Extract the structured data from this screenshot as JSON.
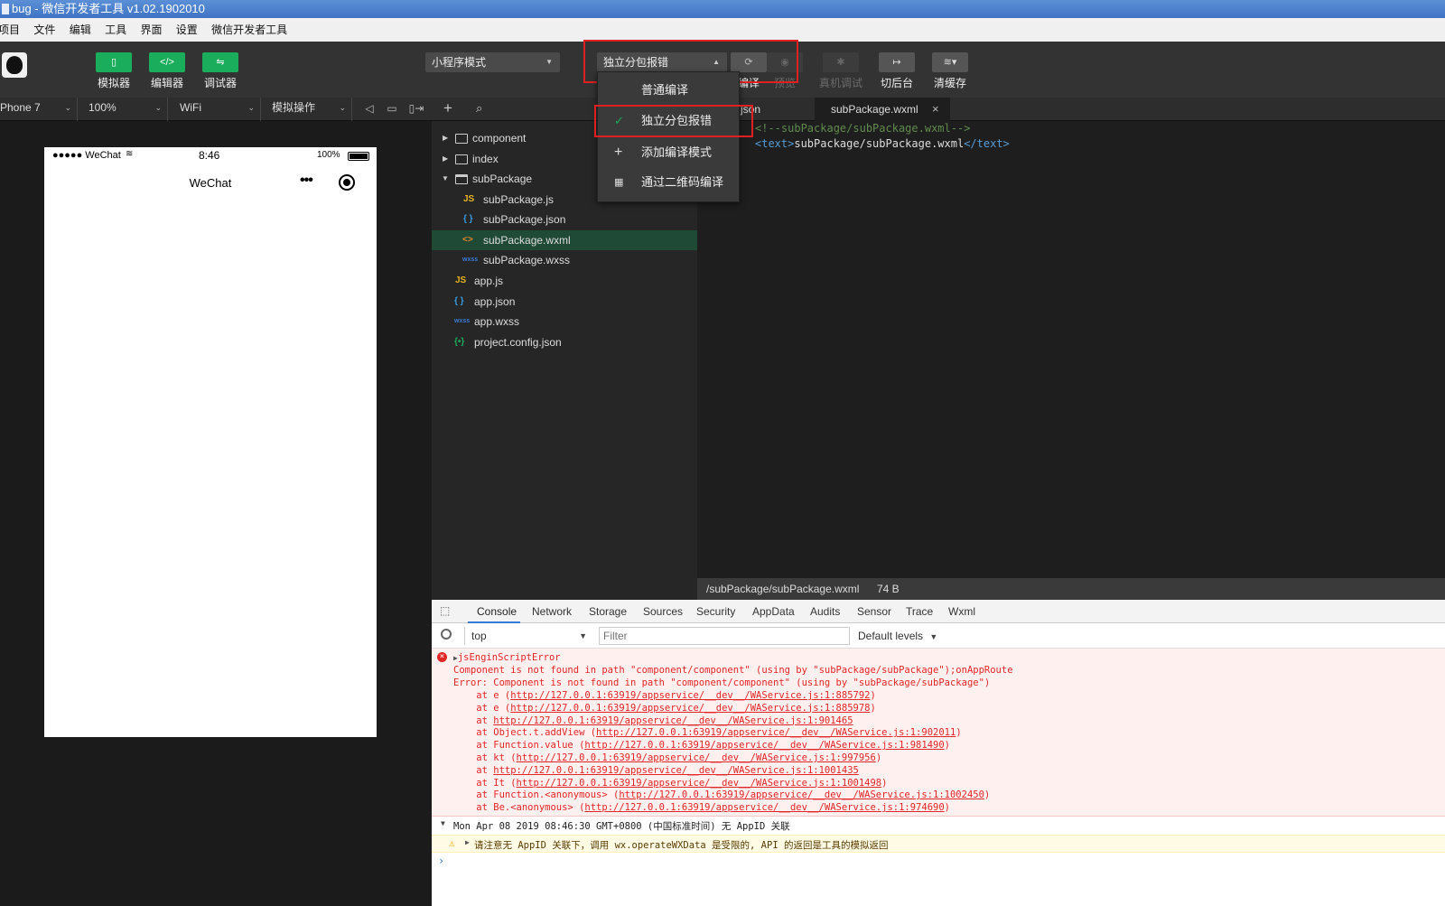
{
  "window": {
    "title": "bug - 微信开发者工具 v1.02.1902010"
  },
  "menu": [
    "项目",
    "文件",
    "编辑",
    "工具",
    "界面",
    "设置",
    "微信开发者工具"
  ],
  "toolbar": {
    "simulator": "模拟器",
    "editor": "编辑器",
    "debugger": "调试器",
    "mode": "小程序模式",
    "compile_mode": "独立分包报错",
    "compile": "编译",
    "preview": "预览",
    "remote_debug": "真机调试",
    "background": "切后台",
    "clear_cache": "清缓存"
  },
  "dropdown": {
    "items": [
      "普通编译",
      "独立分包报错",
      "添加编译模式",
      "通过二维码编译"
    ],
    "selected": "独立分包报错"
  },
  "device_bar": {
    "device": "Phone 7",
    "zoom": "100%",
    "network": "WiFi",
    "operation": "模拟操作"
  },
  "phone": {
    "carrier": "●●●●● WeChat",
    "time": "8:46",
    "battery": "100%",
    "nav_title": "WeChat"
  },
  "tree": {
    "items": [
      {
        "name": "component",
        "type": "folder"
      },
      {
        "name": "index",
        "type": "folder"
      },
      {
        "name": "subPackage",
        "type": "folder-open"
      },
      {
        "name": "subPackage.js",
        "type": "js"
      },
      {
        "name": "subPackage.json",
        "type": "json"
      },
      {
        "name": "subPackage.wxml",
        "type": "wxml",
        "selected": true
      },
      {
        "name": "subPackage.wxss",
        "type": "wxss"
      },
      {
        "name": "app.js",
        "type": "js"
      },
      {
        "name": "app.json",
        "type": "json"
      },
      {
        "name": "app.wxss",
        "type": "wxss"
      },
      {
        "name": "project.config.json",
        "type": "config"
      }
    ]
  },
  "editor": {
    "tabs": [
      "json",
      "subPackage.wxml"
    ],
    "comment": "<!--subPackage/subPackage.wxml-->",
    "tag_open": "<text>",
    "tag_content": "subPackage/subPackage.wxml",
    "tag_close": "</text>",
    "status_path": "/subPackage/subPackage.wxml",
    "status_size": "74 B"
  },
  "devtools": {
    "tabs": [
      "Console",
      "Network",
      "Storage",
      "Sources",
      "Security",
      "AppData",
      "Audits",
      "Sensor",
      "Trace",
      "Wxml"
    ],
    "context": "top",
    "filter_placeholder": "Filter",
    "levels": "Default levels",
    "error_title": "jsEnginScriptError",
    "error_lines": [
      "Component is not found in path \"component/component\" (using by \"subPackage/subPackage\");onAppRoute",
      "Error: Component is not found in path \"component/component\" (using by \"subPackage/subPackage\")"
    ],
    "stack": [
      {
        "prefix": "    at e (",
        "link": "http://127.0.0.1:63919/appservice/__dev__/WAService.js:1:885792",
        "suffix": ")"
      },
      {
        "prefix": "    at e (",
        "link": "http://127.0.0.1:63919/appservice/__dev__/WAService.js:1:885978",
        "suffix": ")"
      },
      {
        "prefix": "    at ",
        "link": "http://127.0.0.1:63919/appservice/__dev__/WAService.js:1:901465",
        "suffix": ""
      },
      {
        "prefix": "    at Object.t.addView (",
        "link": "http://127.0.0.1:63919/appservice/__dev__/WAService.js:1:902011",
        "suffix": ")"
      },
      {
        "prefix": "    at Function.value (",
        "link": "http://127.0.0.1:63919/appservice/__dev__/WAService.js:1:981490",
        "suffix": ")"
      },
      {
        "prefix": "    at kt (",
        "link": "http://127.0.0.1:63919/appservice/__dev__/WAService.js:1:997956",
        "suffix": ")"
      },
      {
        "prefix": "    at ",
        "link": "http://127.0.0.1:63919/appservice/__dev__/WAService.js:1:1001435",
        "suffix": ""
      },
      {
        "prefix": "    at It (",
        "link": "http://127.0.0.1:63919/appservice/__dev__/WAService.js:1:1001498",
        "suffix": ")"
      },
      {
        "prefix": "    at Function.<anonymous> (",
        "link": "http://127.0.0.1:63919/appservice/__dev__/WAService.js:1:1002450",
        "suffix": ")"
      },
      {
        "prefix": "    at Be.<anonymous> (",
        "link": "http://127.0.0.1:63919/appservice/__dev__/WAService.js:1:974690",
        "suffix": ")"
      }
    ],
    "group_header": "Mon Apr 08 2019 08:46:30 GMT+0800 (中国标准时间) 无 AppID 关联",
    "warning": "请注意无 AppID 关联下，调用 wx.operateWXData 是受限的, API 的返回是工具的模拟返回"
  },
  "colors": {
    "accent": "#1aad5c",
    "highlight_box": "#e02020",
    "error": "#e02626"
  }
}
